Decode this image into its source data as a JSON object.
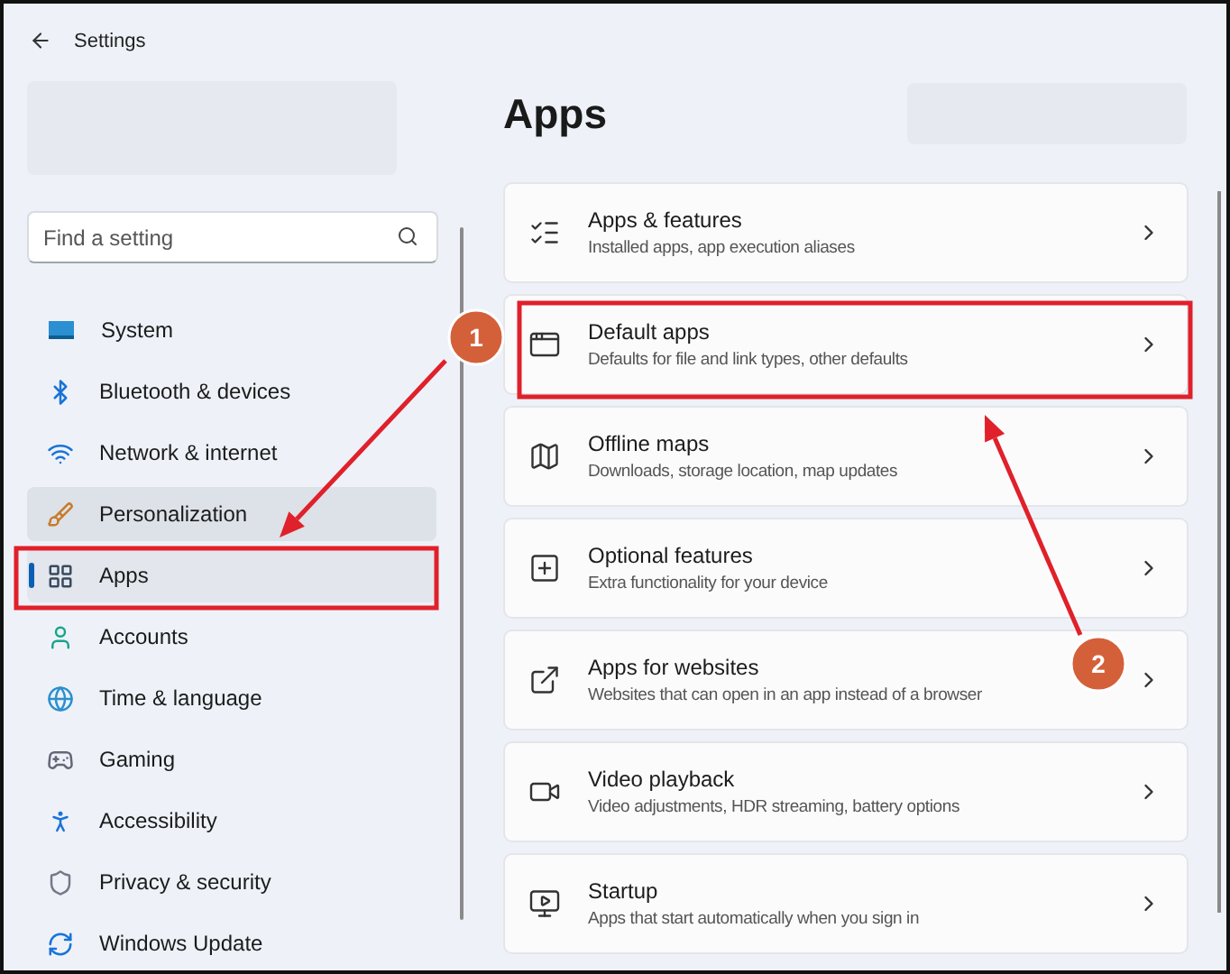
{
  "window": {
    "title": "Settings"
  },
  "search": {
    "placeholder": "Find a setting"
  },
  "nav": [
    {
      "label": "System",
      "selected": false,
      "hovered": false
    },
    {
      "label": "Bluetooth & devices",
      "selected": false,
      "hovered": false
    },
    {
      "label": "Network & internet",
      "selected": false,
      "hovered": false
    },
    {
      "label": "Personalization",
      "selected": false,
      "hovered": true
    },
    {
      "label": "Apps",
      "selected": true,
      "hovered": false
    },
    {
      "label": "Accounts",
      "selected": false,
      "hovered": false
    },
    {
      "label": "Time & language",
      "selected": false,
      "hovered": false
    },
    {
      "label": "Gaming",
      "selected": false,
      "hovered": false
    },
    {
      "label": "Accessibility",
      "selected": false,
      "hovered": false
    },
    {
      "label": "Privacy & security",
      "selected": false,
      "hovered": false
    },
    {
      "label": "Windows Update",
      "selected": false,
      "hovered": false
    }
  ],
  "page": {
    "title": "Apps"
  },
  "cards": [
    {
      "title": "Apps & features",
      "subtitle": "Installed apps, app execution aliases"
    },
    {
      "title": "Default apps",
      "subtitle": "Defaults for file and link types, other defaults"
    },
    {
      "title": "Offline maps",
      "subtitle": "Downloads, storage location, map updates"
    },
    {
      "title": "Optional features",
      "subtitle": "Extra functionality for your device"
    },
    {
      "title": "Apps for websites",
      "subtitle": "Websites that can open in an app instead of a browser"
    },
    {
      "title": "Video playback",
      "subtitle": "Video adjustments, HDR streaming, battery options"
    },
    {
      "title": "Startup",
      "subtitle": "Apps that start automatically when you sign in"
    }
  ],
  "annotations": [
    {
      "label": "1"
    },
    {
      "label": "2"
    }
  ]
}
